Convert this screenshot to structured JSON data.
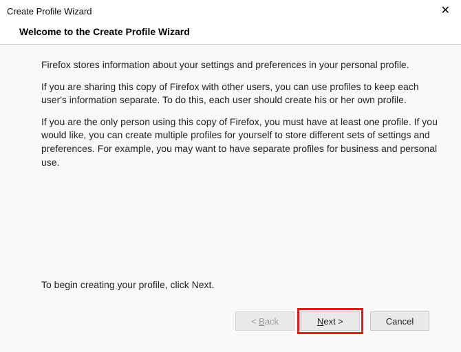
{
  "window": {
    "title": "Create Profile Wizard"
  },
  "header": {
    "heading": "Welcome to the Create Profile Wizard"
  },
  "body": {
    "para1": "Firefox stores information about your settings and preferences in your personal profile.",
    "para2": "If you are sharing this copy of Firefox with other users, you can use profiles to keep each user's information separate. To do this, each user should create his or her own profile.",
    "para3": "If you are the only person using this copy of Firefox, you must have at least one profile. If you would like, you can create multiple profiles for yourself to store different sets of settings and preferences. For example, you may want to have separate profiles for business and personal use.",
    "begin": "To begin creating your profile, click Next."
  },
  "buttons": {
    "back_prefix": "< ",
    "back_key": "B",
    "back_rest": "ack",
    "next_key": "N",
    "next_rest": "ext >",
    "cancel": "Cancel"
  }
}
